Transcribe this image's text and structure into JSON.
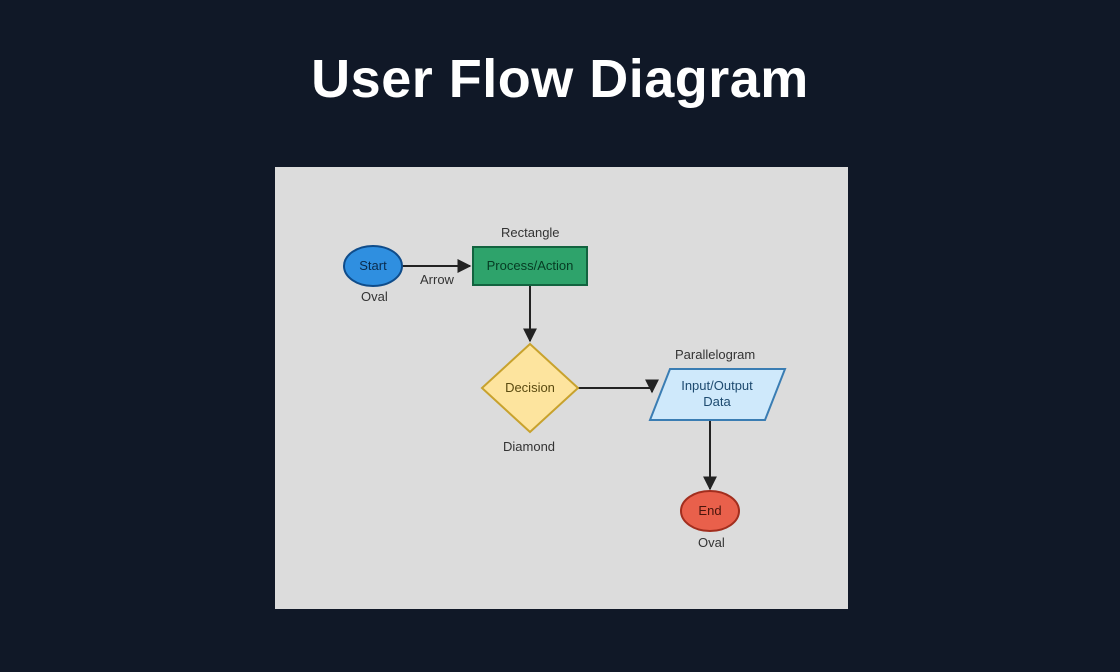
{
  "title": "User Flow Diagram",
  "nodes": {
    "start": {
      "shape": "oval",
      "label": "Start",
      "caption": "Oval",
      "fill": "#2f8fe0",
      "stroke": "#0f4c8a"
    },
    "process": {
      "shape": "rectangle",
      "label": "Process/Action",
      "caption": "Rectangle",
      "fill": "#2ea36b",
      "stroke": "#12633f"
    },
    "decision": {
      "shape": "diamond",
      "label": "Decision",
      "caption": "Diamond",
      "fill": "#fde49e",
      "stroke": "#c8a22d"
    },
    "io": {
      "shape": "parallelogram",
      "label": "Input/Output Data",
      "caption": "Parallelogram",
      "fill": "#cfe9fb",
      "stroke": "#3a7db3"
    },
    "end": {
      "shape": "oval",
      "label": "End",
      "caption": "Oval",
      "fill": "#e9604b",
      "stroke": "#a22e1e"
    }
  },
  "arrowCaption": "Arrow",
  "edges": [
    {
      "from": "start",
      "to": "process"
    },
    {
      "from": "process",
      "to": "decision"
    },
    {
      "from": "decision",
      "to": "io"
    },
    {
      "from": "io",
      "to": "end"
    }
  ]
}
